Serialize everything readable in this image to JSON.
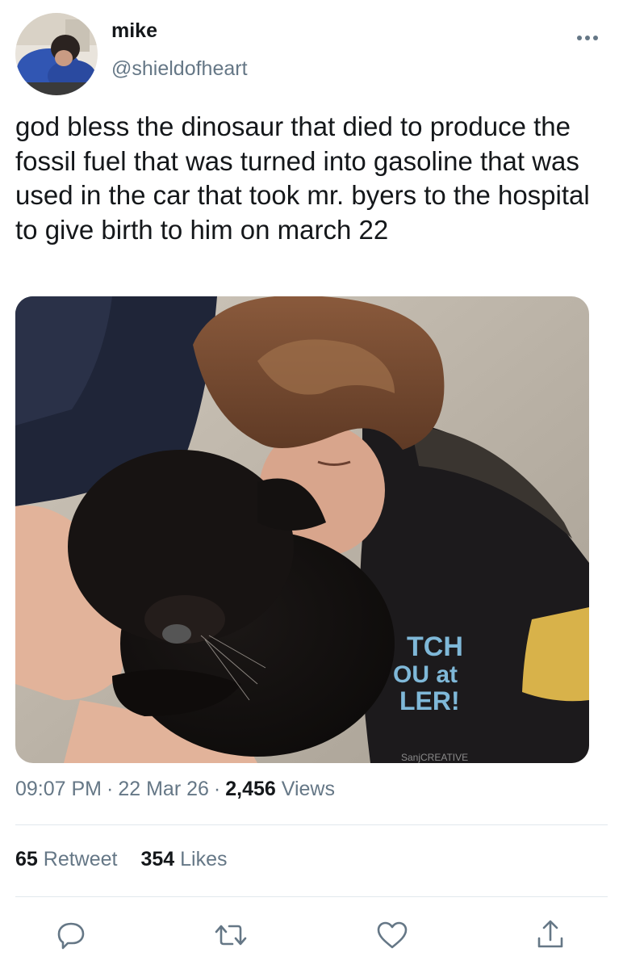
{
  "user": {
    "display_name": "mike",
    "handle": "@shieldofheart"
  },
  "tweet": {
    "text": "god bless the dinosaur that died to produce the fossil fuel that was turned into gasoline that was used in the car that took mr. byers to the hospital to give birth to him on march 22",
    "time": "09:07 PM",
    "date": "22 Mar 26",
    "separator": "·",
    "views_count": "2,456",
    "views_label": "Views"
  },
  "photo": {
    "shirt_text_lines": [
      "TCH",
      "OU at",
      "LER!"
    ],
    "shirt_brand": "SanjCREATIVE"
  },
  "stats": {
    "retweets_count": "65",
    "retweets_label": "Retweet",
    "likes_count": "354",
    "likes_label": "Likes"
  },
  "actions": [
    "reply-icon",
    "retweet-icon",
    "like-icon",
    "share-icon"
  ],
  "colors": {
    "text": "#14171a",
    "secondary": "#657786",
    "divider": "#e1e8ed"
  }
}
